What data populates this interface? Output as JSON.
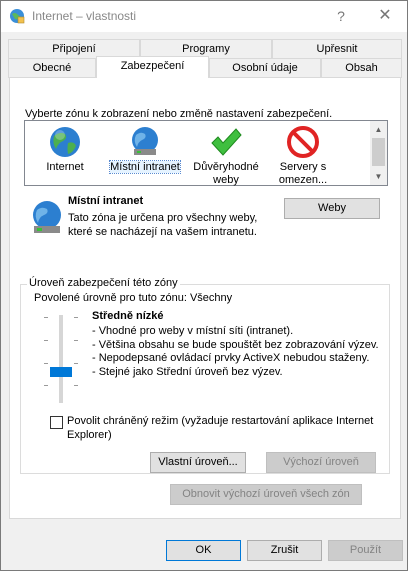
{
  "window": {
    "title": "Internet – vlastnosti",
    "help_glyph": "?",
    "close_glyph": "✕"
  },
  "tabs_row1": [
    {
      "label": "Připojení"
    },
    {
      "label": "Programy"
    },
    {
      "label": "Upřesnit"
    }
  ],
  "tabs_row2": [
    {
      "label": "Obecné"
    },
    {
      "label": "Zabezpečení",
      "active": true
    },
    {
      "label": "Osobní údaje"
    },
    {
      "label": "Obsah"
    }
  ],
  "security": {
    "intro": "Vyberte zónu k zobrazení nebo změně nastavení zabezpečení.",
    "zones": [
      {
        "label": "Internet",
        "icon": "globe-icon"
      },
      {
        "label": "Místní intranet",
        "icon": "intranet-globe-icon",
        "selected": true
      },
      {
        "label": "Důvěryhodné weby",
        "icon": "checkmark-icon"
      },
      {
        "label": "Servery s omezen...",
        "icon": "restricted-icon"
      }
    ],
    "selected_zone_name": "Místní intranet",
    "selected_zone_desc": "Tato zóna je určena pro všechny weby, které se nacházejí na vašem intranetu.",
    "sites_button": "Weby",
    "level_group_title": "Úroveň zabezpečení této zóny",
    "allowed_levels": "Povolené úrovně pro tuto zónu: Všechny",
    "level_name": "Středně nízké",
    "level_fraction": 0.333,
    "level_lines": [
      "- Vhodné pro weby v místní síti (intranet).",
      "- Většina obsahu se bude spouštět bez zobrazování výzev.",
      "- Nepodepsané ovládací prvky ActiveX nebudou staženy.",
      "- Stejné jako Střední úroveň bez výzev."
    ],
    "protected_mode_label": "Povolit chráněný režim (vyžaduje restartování aplikace Internet Explorer)",
    "protected_mode_checked": false,
    "custom_level_button": "Vlastní úroveň...",
    "default_level_button": "Výchozí úroveň",
    "reset_all_button": "Obnovit výchozí úroveň všech zón"
  },
  "footer": {
    "ok": "OK",
    "cancel": "Zrušit",
    "apply": "Použít"
  },
  "colors": {
    "accent": "#0078d7",
    "selection": "#e5f3ff"
  }
}
